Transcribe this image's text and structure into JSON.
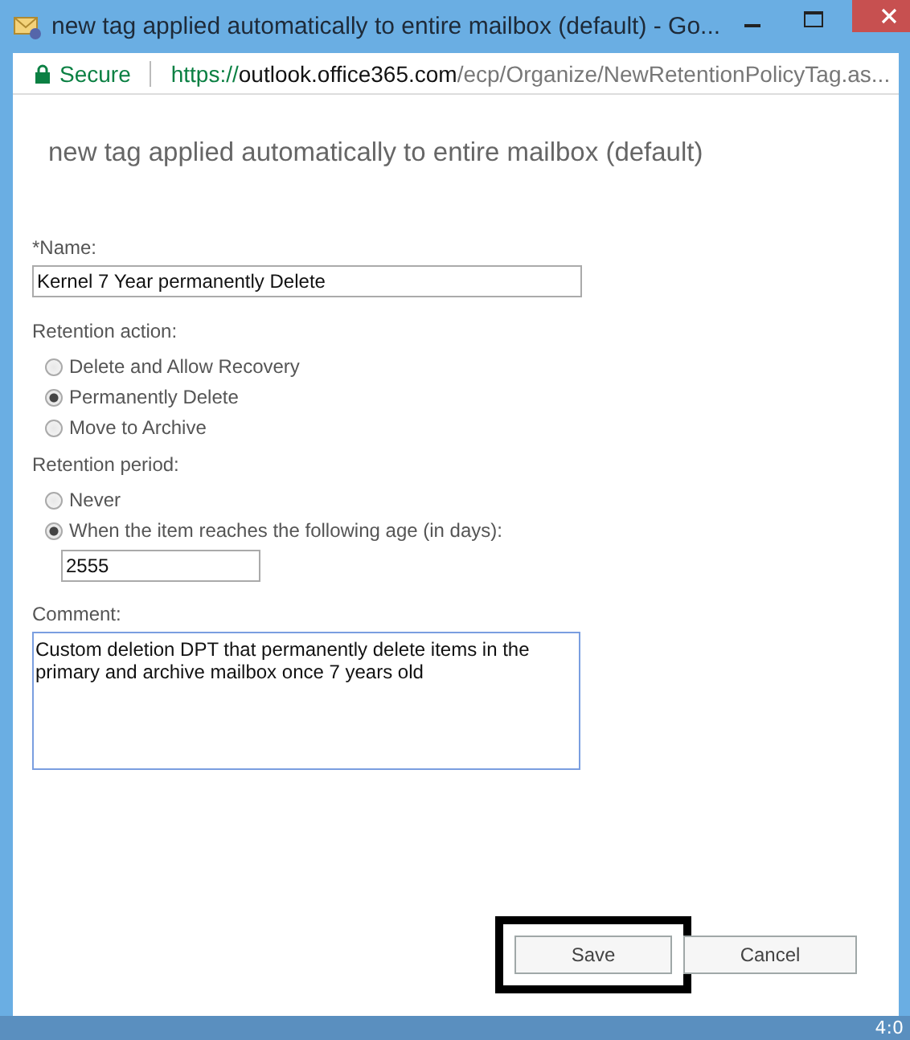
{
  "window": {
    "title": "new tag applied automatically to entire mailbox (default) - Go..."
  },
  "address_bar": {
    "secure_label": "Secure",
    "url_scheme": "https://",
    "url_host": "outlook.office365.com",
    "url_path": "/ecp/Organize/NewRetentionPolicyTag.as..."
  },
  "dialog": {
    "heading": "new tag applied automatically to entire mailbox (default)",
    "name_label": "*Name:",
    "name_value": "Kernel 7 Year permanently Delete",
    "retention_action": {
      "label": "Retention action:",
      "options": [
        {
          "label": "Delete and Allow Recovery",
          "selected": false
        },
        {
          "label": "Permanently Delete",
          "selected": true
        },
        {
          "label": "Move to Archive",
          "selected": false
        }
      ]
    },
    "retention_period": {
      "label": "Retention period:",
      "options": [
        {
          "label": "Never",
          "selected": false
        },
        {
          "label": "When the item reaches the following age (in days):",
          "selected": true
        }
      ],
      "days_value": "2555"
    },
    "comment_label": "Comment:",
    "comment_value": "Custom deletion DPT that permanently delete items in the primary and archive mailbox once 7 years old",
    "buttons": [
      {
        "label": "Save",
        "highlighted": true
      },
      {
        "label": "Cancel",
        "highlighted": false
      }
    ]
  },
  "taskbar": {
    "clock": "4:0"
  }
}
